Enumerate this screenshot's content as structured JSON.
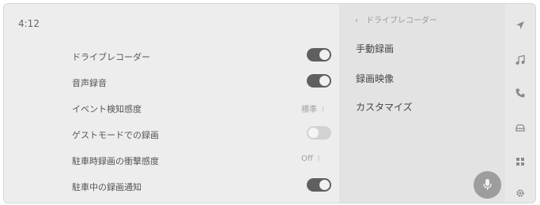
{
  "status_bar": {
    "time": "4:12"
  },
  "settings": {
    "rows": [
      {
        "label": "ドライブレコーダー",
        "control": "toggle",
        "state": "on"
      },
      {
        "label": "音声録音",
        "control": "toggle",
        "state": "on"
      },
      {
        "label": "イベント検知感度",
        "control": "select",
        "value": "標準",
        "chevron": "⁝"
      },
      {
        "label": "ゲストモードでの録画",
        "control": "toggle",
        "state": "off"
      },
      {
        "label": "駐車時録画の衝撃感度",
        "control": "select",
        "value": "Off",
        "chevron": "⁝"
      },
      {
        "label": "駐車中の録画通知",
        "control": "toggle",
        "state": "on"
      }
    ]
  },
  "side_menu": {
    "back_icon": "chevron-left-icon",
    "back_glyph": "‹",
    "header": "ドライブレコーダー",
    "items": [
      {
        "label": "手動録画"
      },
      {
        "label": "録画映像"
      },
      {
        "label": "カスタマイズ"
      }
    ],
    "mic_icon": "microphone-icon"
  },
  "nav_rail": {
    "icons": [
      "navigation-arrow-icon",
      "music-note-icon",
      "phone-icon",
      "car-icon",
      "grid-apps-icon",
      "gear-icon"
    ]
  },
  "colors": {
    "background": "#ececec",
    "right_panel": "#e3e3e3",
    "toggle_on": "#5f5f5f",
    "toggle_off": "#d2d2d2",
    "mic_button": "#9d9d9d"
  }
}
